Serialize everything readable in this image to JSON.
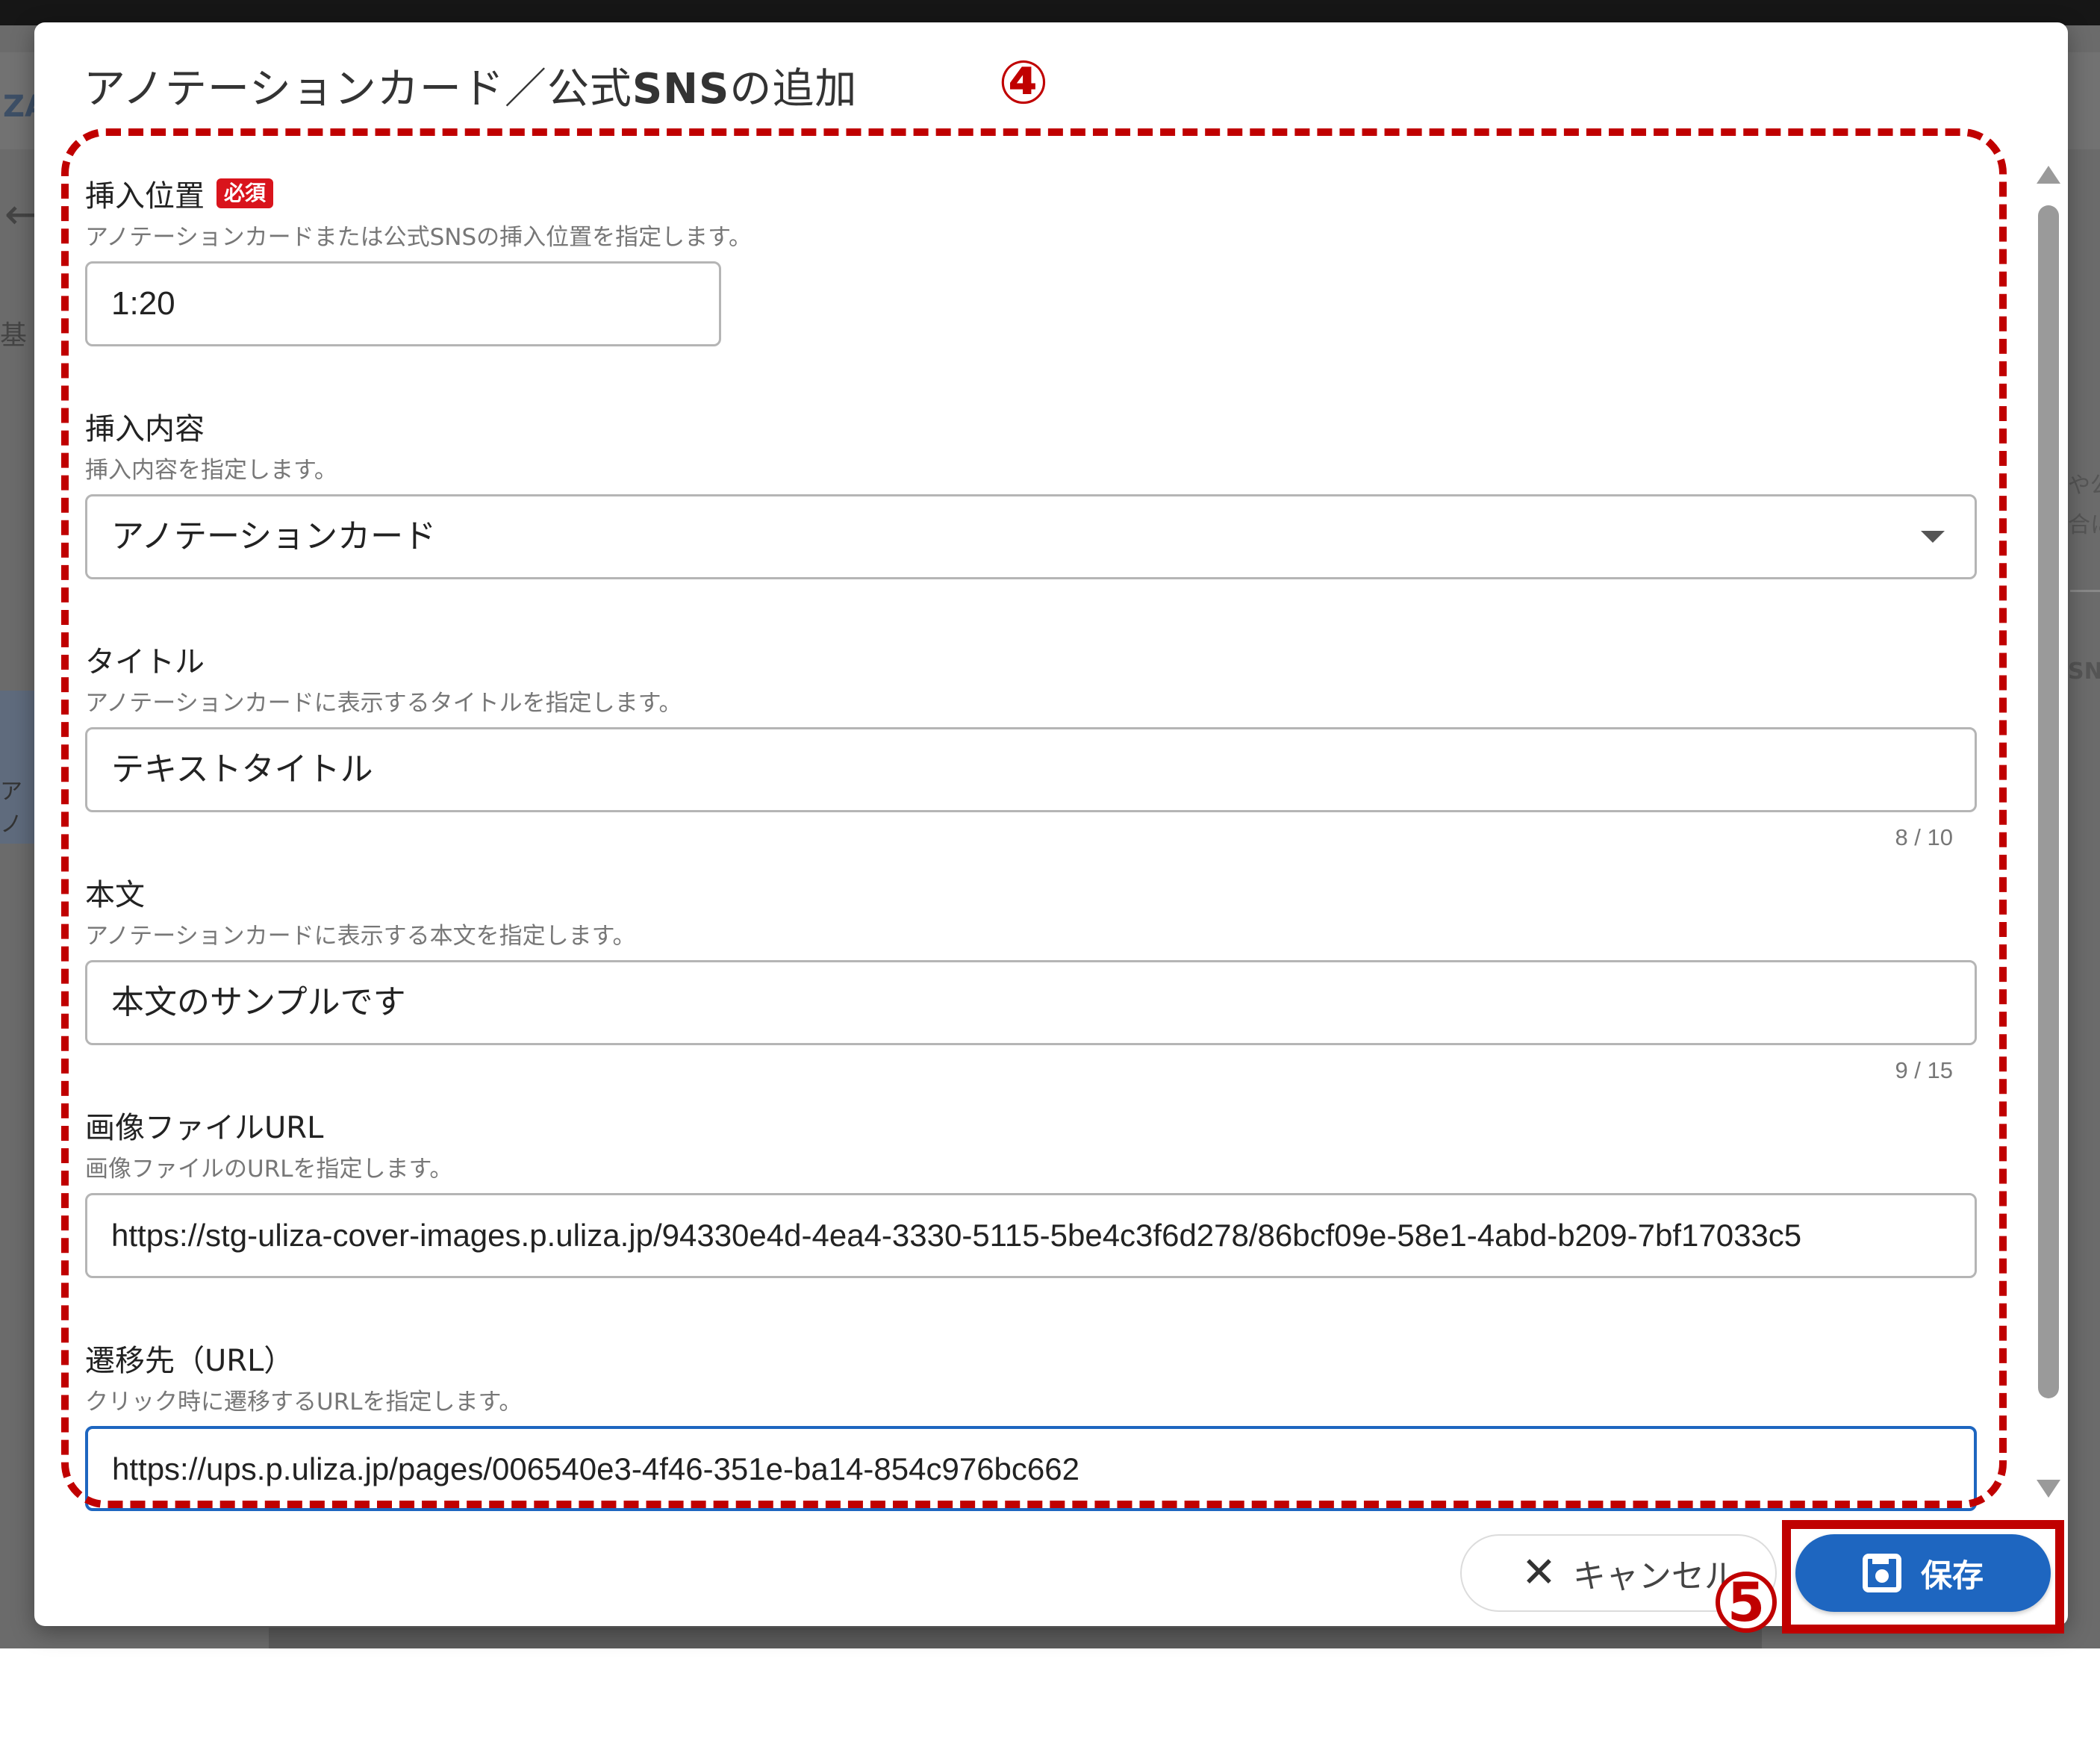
{
  "dialog": {
    "title_prefix": "アノテーションカード／公式",
    "title_bold": "SNS",
    "title_suffix": "の追加"
  },
  "fields": {
    "position": {
      "label": "挿入位置",
      "required_badge": "必須",
      "description": "アノテーションカードまたは公式SNSの挿入位置を指定します。",
      "value": "1:20"
    },
    "content_type": {
      "label": "挿入内容",
      "description": "挿入内容を指定します。",
      "value": "アノテーションカード"
    },
    "title": {
      "label": "タイトル",
      "description": "アノテーションカードに表示するタイトルを指定します。",
      "value": "テキストタイトル",
      "counter": "8 / 10"
    },
    "body": {
      "label": "本文",
      "description": "アノテーションカードに表示する本文を指定します。",
      "value": "本文のサンプルです",
      "counter": "9 / 15"
    },
    "image_url": {
      "label": "画像ファイルURL",
      "description": "画像ファイルのURLを指定します。",
      "value": "https://stg-uliza-cover-images.p.uliza.jp/94330e4d-4ea4-3330-5115-5be4c3f6d278/86bcf09e-58e1-4abd-b209-7bf17033c5"
    },
    "link_url": {
      "label": "遷移先（URL）",
      "description": "クリック時に遷移するURLを指定します。",
      "value": "https://ups.p.uliza.jp/pages/006540e3-4f46-351e-ba14-854c976bc662"
    }
  },
  "buttons": {
    "cancel_label": "キャンセル",
    "cancel_icon": "close-icon",
    "save_label": "保存",
    "save_icon": "floppy-disk-icon"
  },
  "annotations": {
    "marker_4": "④",
    "marker_5": "5"
  },
  "background": {
    "logo": "ZA",
    "left_label": "基",
    "left_panel_text": "アノ",
    "right_text_1": "や公",
    "right_text_2": "合に",
    "right_text_3": "SN"
  },
  "colors": {
    "primary": "#1e66c0",
    "required": "#d9141c",
    "annotation": "#c00000"
  }
}
